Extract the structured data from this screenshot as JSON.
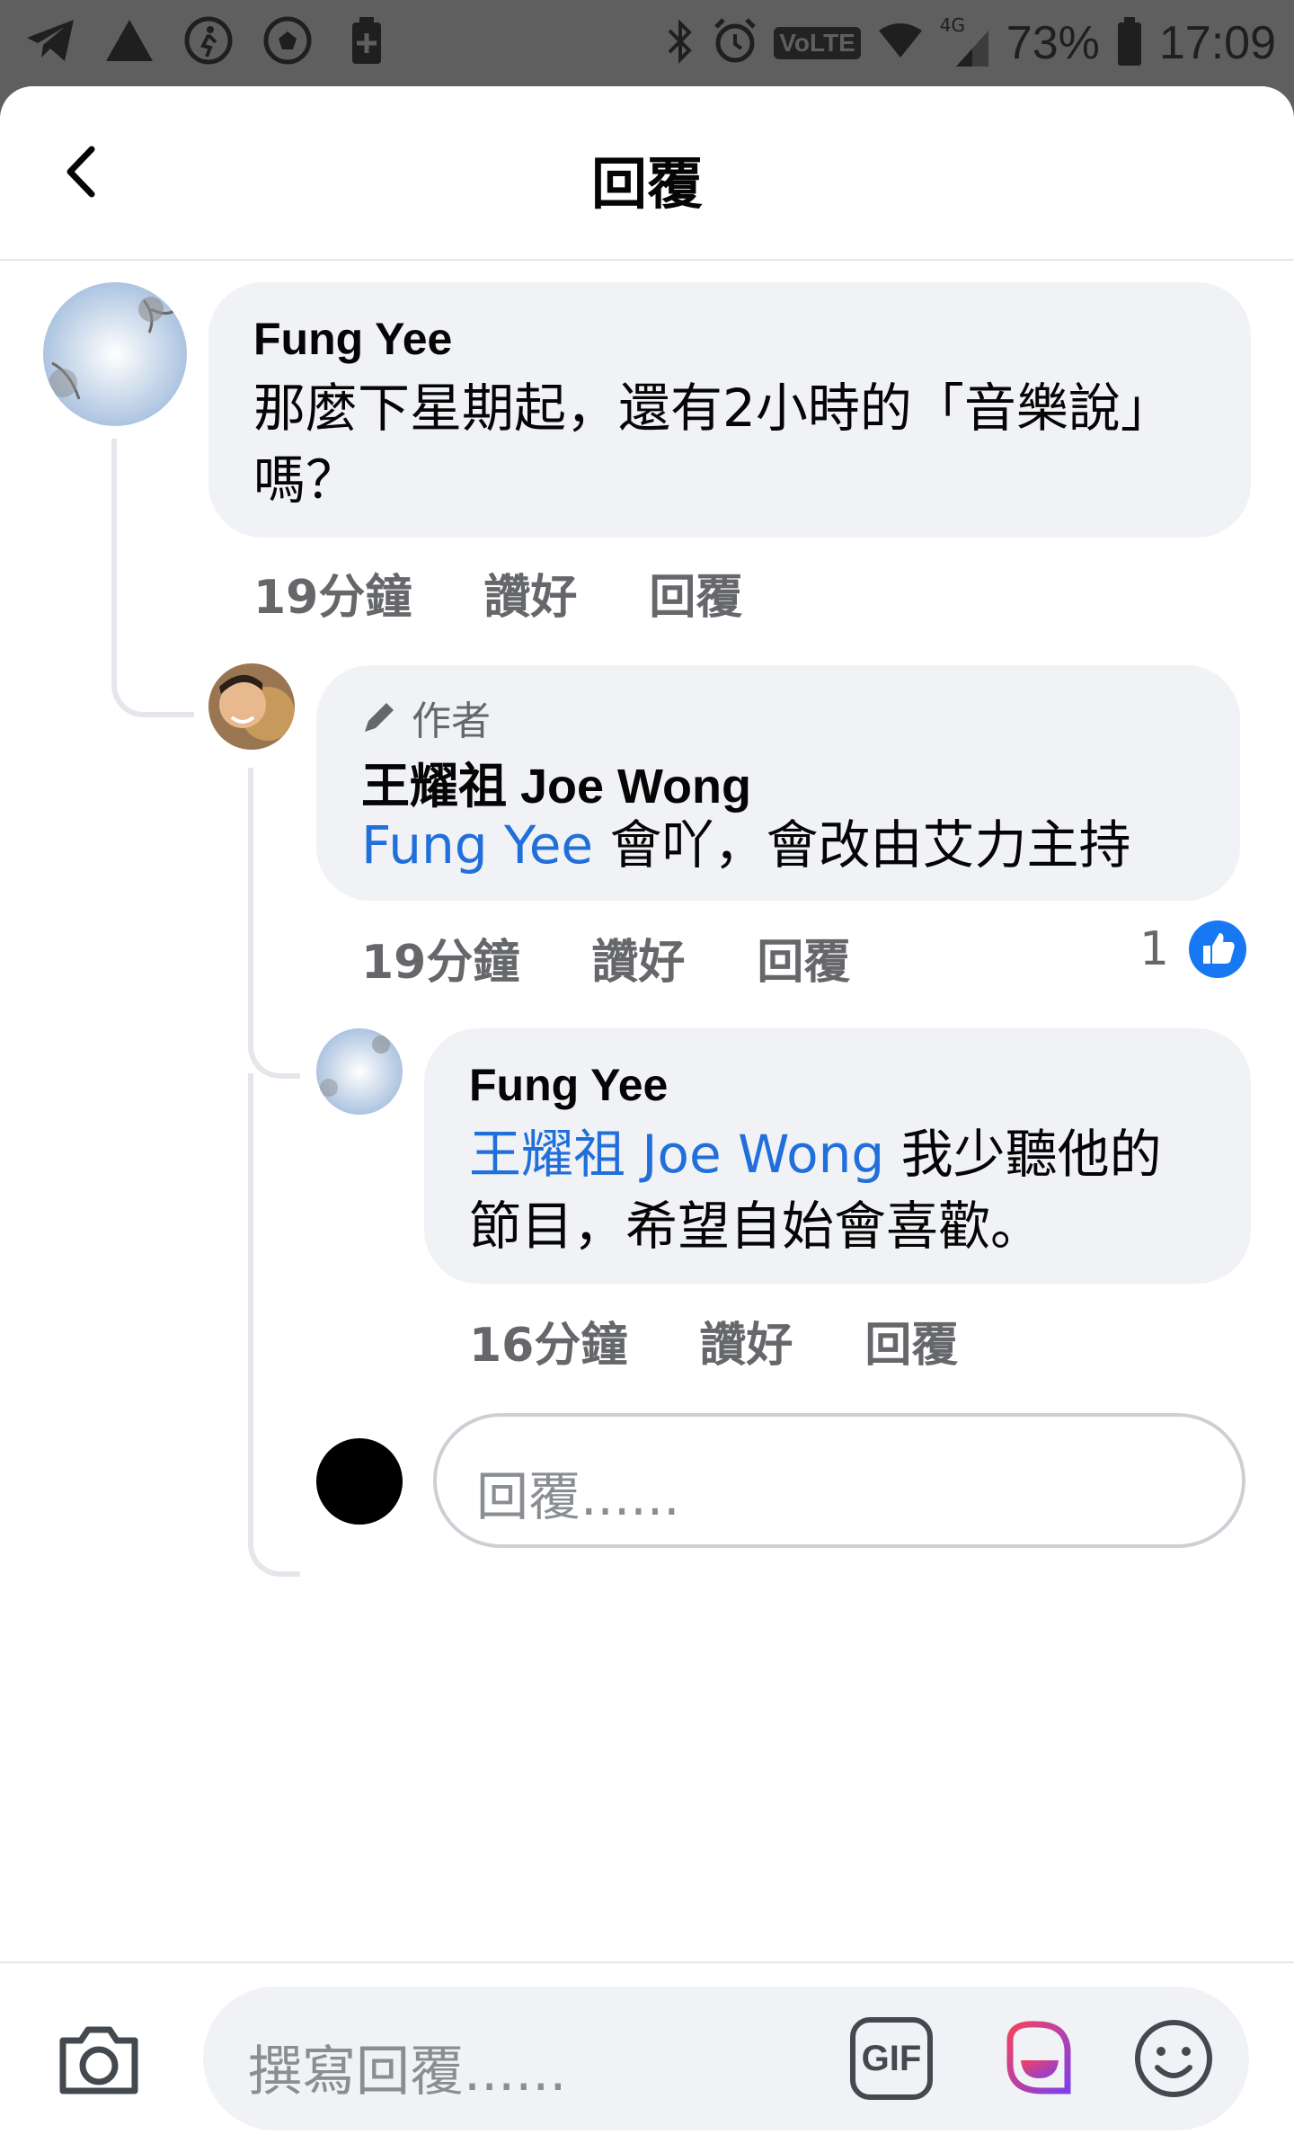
{
  "status_bar": {
    "battery": "73%",
    "time": "17:09",
    "network": "4G",
    "volte": "VoLTE",
    "left_icons": [
      "telegram-icon",
      "warning-triangle-icon",
      "pedometer-icon",
      "football-icon",
      "battery-saver-icon"
    ],
    "right_icons": [
      "bluetooth-icon",
      "alarm-icon",
      "volte-icon",
      "wifi-icon",
      "signal-icon",
      "battery-icon"
    ]
  },
  "header": {
    "title": "回覆",
    "back_icon": "chevron-left-icon"
  },
  "comments": [
    {
      "author": "Fung Yee",
      "text": "那麼下星期起，還有2小時的「音樂說」嗎？",
      "time": "19分鐘",
      "like_label": "讚好",
      "reply_label": "回覆"
    },
    {
      "badge": "作者",
      "author": "王耀祖 Joe Wong",
      "mention": "Fung Yee",
      "text": " 會吖，會改由艾力主持",
      "time": "19分鐘",
      "like_label": "讚好",
      "reply_label": "回覆",
      "reaction_count": "1"
    },
    {
      "author": "Fung Yee",
      "mention": "王耀祖 Joe Wong",
      "text": " 我少聽他的節目，希望自始會喜歡。",
      "time": "16分鐘",
      "like_label": "讚好",
      "reply_label": "回覆"
    }
  ],
  "reply_box": {
    "placeholder": "回覆......"
  },
  "composer": {
    "placeholder": "撰寫回覆......",
    "gif_label": "GIF"
  },
  "colors": {
    "link": "#216fdb",
    "bubble": "#f0f2f5",
    "meta": "#65676b",
    "like_blue": "#1877f2"
  }
}
